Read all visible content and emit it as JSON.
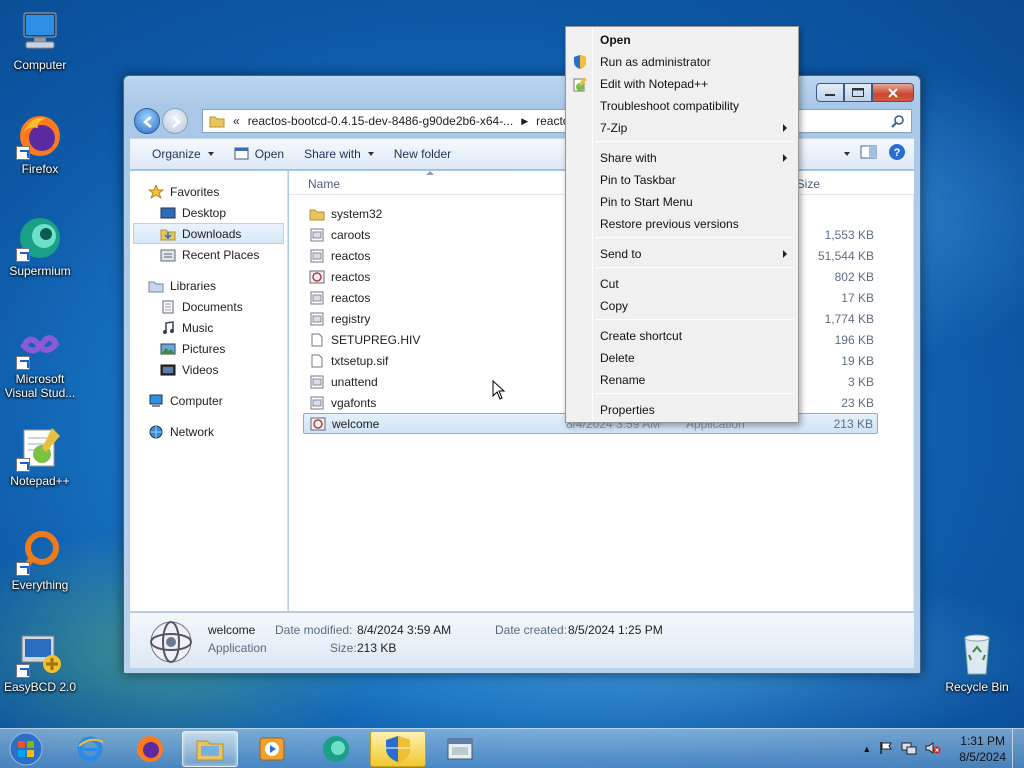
{
  "desktop": {
    "icons": [
      {
        "label": "Computer"
      },
      {
        "label": "Firefox"
      },
      {
        "label": "Supermium"
      },
      {
        "label": "Microsoft Visual Stud..."
      },
      {
        "label": "Notepad++"
      },
      {
        "label": "Everything"
      },
      {
        "label": "EasyBCD 2.0"
      },
      {
        "label": "Recycle Bin"
      }
    ]
  },
  "explorer": {
    "address": {
      "chevrons": "«",
      "crumb1": "reactos-bootcd-0.4.15-dev-8486-g90de2b6-x64-...",
      "crumb2": "reactos"
    },
    "toolbar": {
      "organize": "Organize",
      "open": "Open",
      "share_with": "Share with",
      "new_folder": "New folder"
    },
    "nav": {
      "favorites": "Favorites",
      "desktop": "Desktop",
      "downloads": "Downloads",
      "recent": "Recent Places",
      "libraries": "Libraries",
      "documents": "Documents",
      "music": "Music",
      "pictures": "Pictures",
      "videos": "Videos",
      "computer": "Computer",
      "network": "Network"
    },
    "columns": {
      "name": "Name",
      "size": "Size"
    },
    "files": [
      {
        "name": "system32",
        "size": "",
        "icon": "folder-icon"
      },
      {
        "name": "caroots",
        "size": "1,553 KB",
        "icon": "file-icon"
      },
      {
        "name": "reactos",
        "size": "51,544 KB",
        "icon": "file-icon"
      },
      {
        "name": "reactos",
        "size": "802 KB",
        "icon": "app-icon"
      },
      {
        "name": "reactos",
        "size": "17 KB",
        "icon": "file-icon"
      },
      {
        "name": "registry",
        "size": "1,774 KB",
        "icon": "file-icon"
      },
      {
        "name": "SETUPREG.HIV",
        "size": "196 KB",
        "icon": "blank-file-icon"
      },
      {
        "name": "txtsetup.sif",
        "size": "19 KB",
        "icon": "blank-file-icon"
      },
      {
        "name": "unattend",
        "size": "3 KB",
        "icon": "file-icon"
      },
      {
        "name": "vgafonts",
        "size": "23 KB",
        "icon": "file-icon"
      },
      {
        "name": "welcome",
        "size": "213 KB",
        "icon": "app-icon",
        "modified": "8/4/2024 3:59 AM",
        "type": "Application"
      }
    ],
    "details": {
      "name": "welcome",
      "type": "Application",
      "modified_label": "Date modified:",
      "modified": "8/4/2024 3:59 AM",
      "created_label": "Date created:",
      "created": "8/5/2024 1:25 PM",
      "size_label": "Size:",
      "size": "213 KB"
    }
  },
  "context_menu": {
    "items": [
      {
        "label": "Open"
      },
      {
        "label": "Run as administrator"
      },
      {
        "label": "Edit with Notepad++"
      },
      {
        "label": "Troubleshoot compatibility"
      },
      {
        "label": "7-Zip"
      },
      {
        "label": "Share with"
      },
      {
        "label": "Pin to Taskbar"
      },
      {
        "label": "Pin to Start Menu"
      },
      {
        "label": "Restore previous versions"
      },
      {
        "label": "Send to"
      },
      {
        "label": "Cut"
      },
      {
        "label": "Copy"
      },
      {
        "label": "Create shortcut"
      },
      {
        "label": "Delete"
      },
      {
        "label": "Rename"
      },
      {
        "label": "Properties"
      }
    ]
  },
  "taskbar": {
    "time": "1:31 PM",
    "date": "8/5/2024"
  },
  "colors": {
    "accent": "#1a78c8",
    "selection": "#cfe3f7",
    "menu_bg": "#f0f0f0"
  }
}
